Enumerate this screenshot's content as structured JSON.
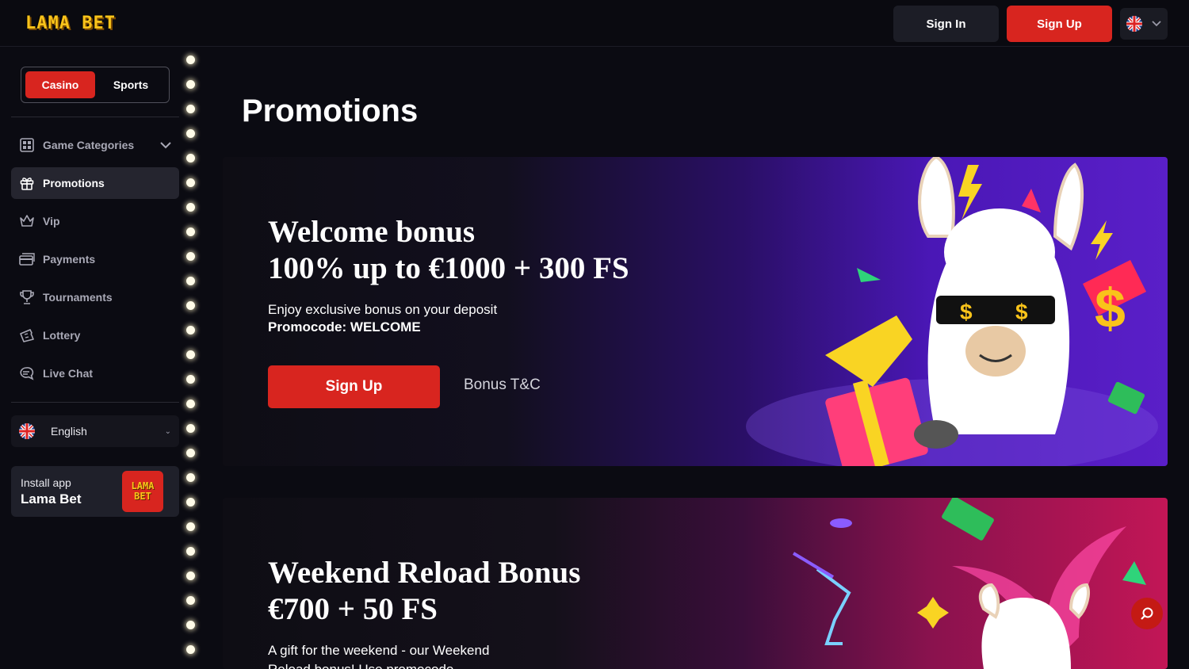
{
  "header": {
    "logo_text": "LAMA BET",
    "signin_label": "Sign In",
    "signup_label": "Sign Up",
    "language_flag": "uk-flag-icon"
  },
  "sidebar": {
    "modes": [
      {
        "label": "Casino",
        "active": true
      },
      {
        "label": "Sports",
        "active": false
      }
    ],
    "nav": [
      {
        "label": "Game Categories",
        "icon": "grid-icon"
      },
      {
        "label": "Promotions",
        "icon": "gift-icon",
        "active": true
      },
      {
        "label": "Vip",
        "icon": "crown-icon"
      },
      {
        "label": "Payments",
        "icon": "card-icon"
      },
      {
        "label": "Tournaments",
        "icon": "trophy-icon"
      },
      {
        "label": "Lottery",
        "icon": "ticket-icon"
      },
      {
        "label": "Live Chat",
        "icon": "chat-icon"
      }
    ],
    "language": "English",
    "install": {
      "line1": "Install app",
      "line2": "Lama Bet",
      "logo_top": "LAMA",
      "logo_bottom": "BET"
    }
  },
  "main": {
    "title": "Promotions",
    "promotions": [
      {
        "title_line1": "Welcome bonus",
        "title_line2": "100% up to €1000 + 300 FS",
        "description": "Enjoy exclusive bonus on your deposit",
        "promocode": "Promocode: WELCOME",
        "signup_label": "Sign Up",
        "tc_label": "Bonus T&C"
      },
      {
        "title_line1": "Weekend Reload Bonus",
        "title_line2": "€700 + 50 FS",
        "description_line1": "A gift for the weekend - our Weekend",
        "description_line2": "Reload bonus! Use promocode"
      }
    ]
  },
  "colors": {
    "accent_red": "#d8251f",
    "page_bg": "#0b0b12",
    "logo_yellow": "#f9c31a"
  }
}
